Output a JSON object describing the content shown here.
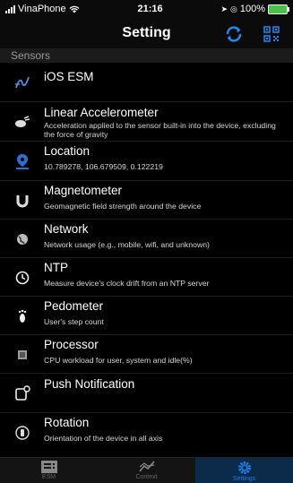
{
  "status_bar": {
    "carrier": "VinaPhone",
    "time": "21:16",
    "battery": "100%"
  },
  "nav": {
    "title": "Setting",
    "sync_icon": "refresh-icon",
    "qr_icon": "qr-code-icon"
  },
  "section": {
    "label": "Sensors"
  },
  "sensors": [
    {
      "title": "iOS ESM",
      "subtitle": "",
      "icon": "esm-icon"
    },
    {
      "title": "Linear Accelerometer",
      "subtitle": "Acceleration applied to the sensor built-in into the device, excluding the force of gravity",
      "icon": "accelerometer-icon"
    },
    {
      "title": "Location",
      "subtitle": "10.789278, 106.679509, 0.122219",
      "icon": "location-icon"
    },
    {
      "title": "Magnetometer",
      "subtitle": "Geomagnetic field strength around the device",
      "icon": "magnet-icon"
    },
    {
      "title": "Network",
      "subtitle": "Network usage (e.g., mobile, wifi, and unknown)",
      "icon": "globe-icon"
    },
    {
      "title": "NTP",
      "subtitle": "Measure device's clock drift from an NTP server",
      "icon": "clock-icon"
    },
    {
      "title": "Pedometer",
      "subtitle": "User's step count",
      "icon": "footprint-icon"
    },
    {
      "title": "Processor",
      "subtitle": "CPU workload for user, system and idle(%)",
      "icon": "cpu-icon"
    },
    {
      "title": "Push Notification",
      "subtitle": "",
      "icon": "notification-icon"
    },
    {
      "title": "Rotation",
      "subtitle": "Orientation of the device in all axis",
      "icon": "rotation-icon"
    }
  ],
  "tabs": [
    {
      "label": "ESM",
      "icon": "list-icon",
      "active": false
    },
    {
      "label": "Context",
      "icon": "chart-icon",
      "active": false
    },
    {
      "label": "Settings",
      "icon": "gear-icon",
      "active": true
    }
  ]
}
